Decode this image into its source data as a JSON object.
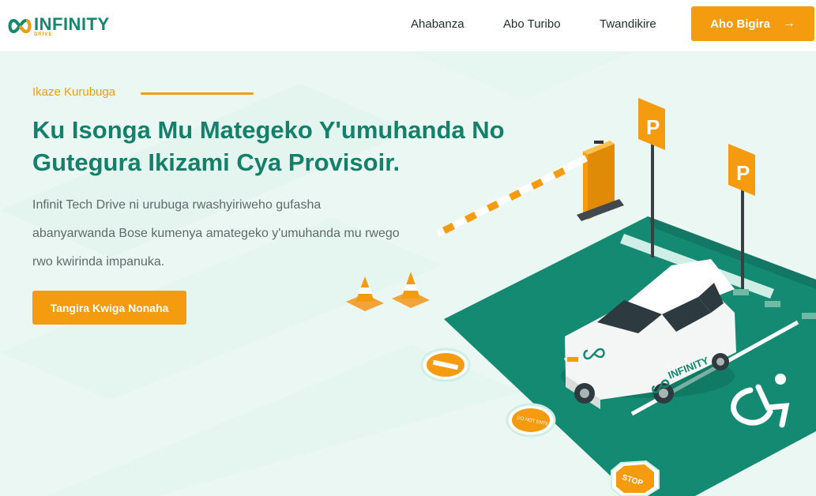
{
  "brand": {
    "name": "INFINITY",
    "sub": "DRIVE",
    "color_primary": "#15876f",
    "color_accent": "#f49b10"
  },
  "nav": {
    "items": [
      {
        "label": "Ahabanza"
      },
      {
        "label": "Abo Turibo"
      },
      {
        "label": "Twandikire"
      }
    ],
    "cta_label": "Aho Bigira",
    "cta_icon": "arrow-right-icon"
  },
  "hero": {
    "kicker": "Ikaze Kurubuga",
    "title": "Ku Isonga Mu Mategeko Y'umuhanda No Gutegura Ikizami Cya Provisoir.",
    "description": "Infinit Tech Drive ni urubuga rwashyiriweho gufasha abanyarwanda Bose kumenya amategeko y'umuhanda mu rwego rwo kwirinda impanuka.",
    "button_label": "Tangira Kwiga Nonaha"
  },
  "illustration": {
    "parking_sign": "P",
    "car_brand": "INFINITY",
    "do_not_enter": "DO NOT ENTER",
    "stop": "STOP"
  }
}
